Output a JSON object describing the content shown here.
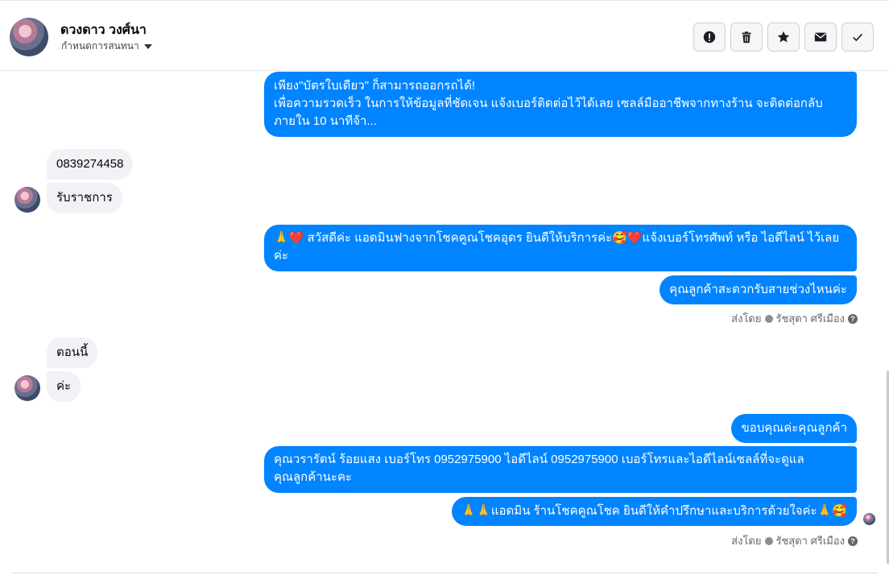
{
  "header": {
    "contact_name": "ดวงดาว วงศ์นา",
    "subtitle": "กำหนดการสนทนา",
    "actions": [
      {
        "icon": "alert-icon"
      },
      {
        "icon": "trash-icon"
      },
      {
        "icon": "star-icon"
      },
      {
        "icon": "envelope-icon"
      },
      {
        "icon": "check-icon"
      }
    ]
  },
  "messages": {
    "out1": {
      "line1": "เพียง\"บัตรใบเดียว\" ก็สามารถออกรถได้!",
      "line2": "เพื่อความรวดเร็ว ในการให้ข้อมูลที่ชัดเจน แจ้งเบอร์ติดต่อไว้ได้เลย เซลล์มืออาชีพจากทางร้าน จะติดต่อกลับ",
      "line3": "ภายใน 10 นาทีจ้า..."
    },
    "in1": "0839274458",
    "in2": "รับราชการ",
    "out2": {
      "line1": "🙏❤️ สวัสดีค่ะ แอดมินฟางจากโชคคูณโชคอุดร ยินดีให้บริการค่ะ🥰❤️แจ้งเบอร์โทรศัพท์ หรือ ไอดีไลน์  ไว้เลย",
      "line2": "ค่ะ"
    },
    "out3": "คุณลูกค้าสะดวกรับสายช่วงไหนค่ะ",
    "sent_by_1": "ส่งโดย",
    "sender_1": "รัชสุดา ศรีเมือง",
    "in3": "ตอนนี้",
    "in4": "ค่ะ",
    "out4": "ขอบคุณค่ะคุณลูกค้า",
    "out5": {
      "line1": "คุณวรารัตน์ ร้อยแสง       เบอร์โทร 0952975900  ไอดีไลน์ 0952975900   เบอร์โทรและไอดีไลน์เซลล์ที่จะดูแล",
      "line2": "คุณลูกค้านะคะ"
    },
    "out6": "🙏🙏แอดมิน ร้านโชคคูณโชค ยินดีให้คำปรึกษาและบริการด้วยใจค่ะ🙏🥰",
    "sent_by_2": "ส่งโดย",
    "sender_2": "รัชสุดา ศรีเมือง",
    "help_glyph": "?"
  },
  "colors": {
    "outgoing_bubble": "#0084ff",
    "incoming_bubble": "#f0f2f5"
  }
}
